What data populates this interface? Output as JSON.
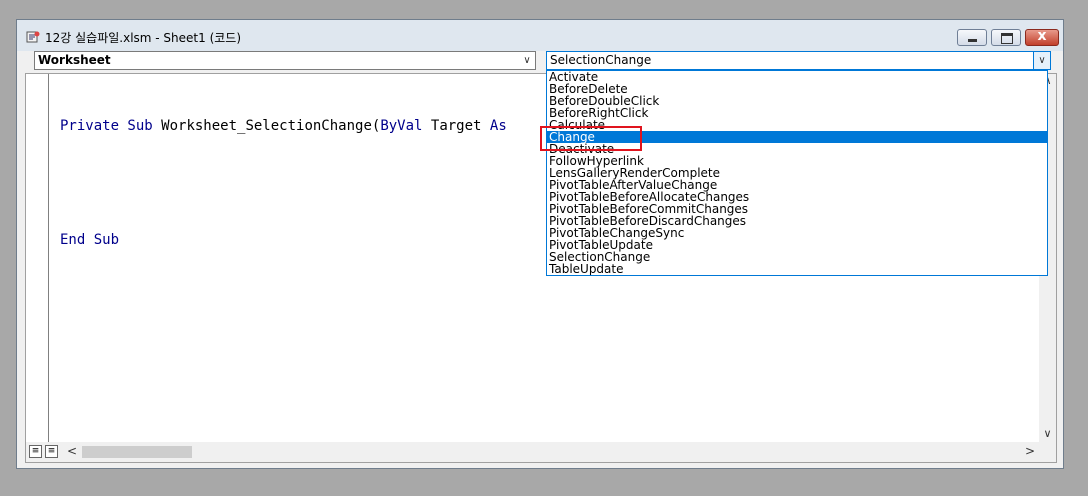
{
  "window": {
    "title": "12강 실습파일.xlsm - Sheet1 (코드)",
    "icon": "vba-module-icon",
    "close_glyph": "x"
  },
  "object_combo": {
    "value": "Worksheet"
  },
  "procedure_combo": {
    "value": "SelectionChange"
  },
  "code": {
    "line1": {
      "kw1": "Private Sub ",
      "text": "Worksheet_SelectionChange(",
      "kw2": "ByVal",
      "text2": " Target ",
      "kw3": "As"
    },
    "line3": {
      "kw": "End Sub"
    }
  },
  "dropdown": {
    "items": [
      "Activate",
      "BeforeDelete",
      "BeforeDoubleClick",
      "BeforeRightClick",
      "Calculate",
      "Change",
      "Deactivate",
      "FollowHyperlink",
      "LensGalleryRenderComplete",
      "PivotTableAfterValueChange",
      "PivotTableBeforeAllocateChanges",
      "PivotTableBeforeCommitChanges",
      "PivotTableBeforeDiscardChanges",
      "PivotTableChangeSync",
      "PivotTableUpdate",
      "SelectionChange",
      "TableUpdate"
    ],
    "selected_index": 5
  },
  "colors": {
    "keyword": "#00008b",
    "selection": "#0078d7",
    "annotation": "#e0141e"
  }
}
